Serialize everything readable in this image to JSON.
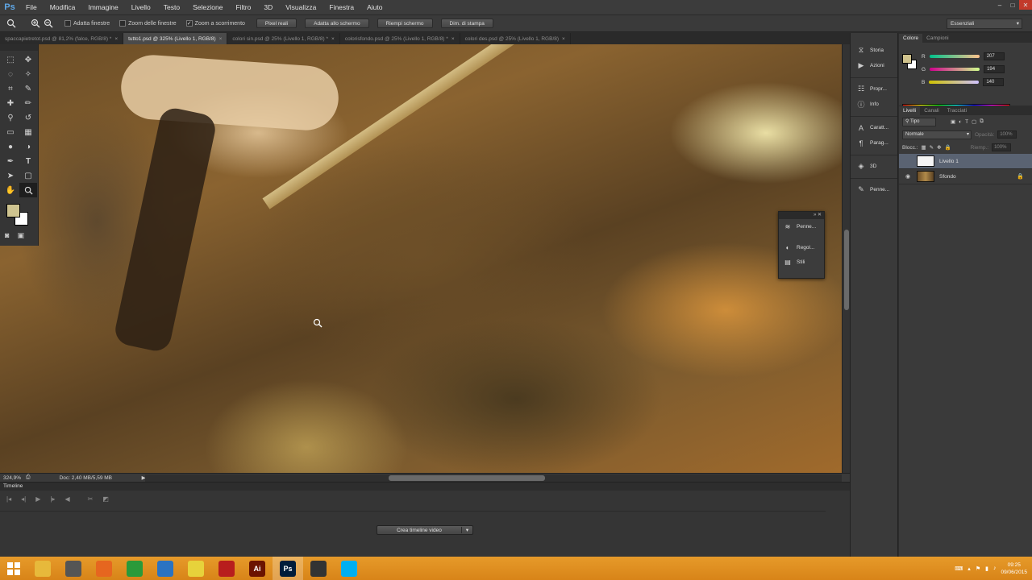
{
  "app": {
    "logo": "Ps"
  },
  "menu": [
    "File",
    "Modifica",
    "Immagine",
    "Livello",
    "Testo",
    "Selezione",
    "Filtro",
    "3D",
    "Visualizza",
    "Finestra",
    "Aiuto"
  ],
  "window_controls": [
    "–",
    "□",
    "✕"
  ],
  "options": {
    "checks": [
      {
        "label": "Adatta finestre",
        "checked": false
      },
      {
        "label": "Zoom delle finestre",
        "checked": false
      },
      {
        "label": "Zoom a scorrimento",
        "checked": true
      }
    ],
    "buttons": [
      "Pixel reali",
      "Adatta allo schermo",
      "Riempi schermo",
      "Dim. di stampa"
    ],
    "workspace": "Essenziali"
  },
  "tabs": [
    {
      "label": "spaccapietretot.psd @ 81,2% (falce, RGB/8) *",
      "active": false
    },
    {
      "label": "tutto1.psd @ 325% (Livello 1, RGB/8)",
      "active": true
    },
    {
      "label": "colori sin.psd @ 25% (Livello 1, RGB/8) *",
      "active": false
    },
    {
      "label": "colorisfondo.psd @ 25% (Livello 1, RGB/8) *",
      "active": false
    },
    {
      "label": "colori des.psd @ 25% (Livello 1, RGB/8)",
      "active": false
    }
  ],
  "status": {
    "zoom": "324,9%",
    "doc": "Doc: 2,40 MB/5,59 MB"
  },
  "timeline": {
    "title": "Timeline",
    "create_button": "Crea timeline video"
  },
  "float_panel": [
    {
      "icon": "brush-presets-icon",
      "label": "Penne..."
    },
    {
      "icon": "adjustments-icon",
      "label": "Regol..."
    },
    {
      "icon": "styles-icon",
      "label": "Stili"
    }
  ],
  "dock": [
    {
      "icon": "history-icon",
      "label": "Storia"
    },
    {
      "icon": "play-icon",
      "label": "Azioni"
    },
    {
      "icon": "properties-icon",
      "label": "Propr..."
    },
    {
      "icon": "info-icon",
      "label": "Info"
    },
    {
      "icon": "character-icon",
      "label": "Caratt..."
    },
    {
      "icon": "paragraph-icon",
      "label": "Parag..."
    },
    {
      "icon": "3d-icon",
      "label": "3D"
    },
    {
      "icon": "brush-icon",
      "label": "Penne..."
    }
  ],
  "color_panel": {
    "tabs": [
      "Colore",
      "Campioni"
    ],
    "fg_color": "#cfc28c",
    "channels": [
      {
        "name": "R",
        "value": "207"
      },
      {
        "name": "G",
        "value": "194"
      },
      {
        "name": "B",
        "value": "140"
      }
    ]
  },
  "layers_panel": {
    "tabs": [
      "Livelli",
      "Canali",
      "Tracciati"
    ],
    "filter": "Tipo",
    "blend_mode": "Normale",
    "opacity_label": "Opacità:",
    "opacity_value": "100%",
    "lock_label": "Blocc.:",
    "fill_label": "Riemp.:",
    "fill_value": "100%",
    "layers": [
      {
        "name": "Livello 1",
        "selected": true,
        "visible": false
      },
      {
        "name": "Sfondo",
        "selected": false,
        "visible": true,
        "locked": true
      }
    ]
  },
  "taskbar": {
    "apps": [
      {
        "icon": "file-explorer-icon",
        "color": "#e7b93b"
      },
      {
        "icon": "steam-icon",
        "color": "#555"
      },
      {
        "icon": "firefox-icon",
        "color": "#e6661f"
      },
      {
        "icon": "spreadsheet-icon",
        "color": "#2a9a3a"
      },
      {
        "icon": "chrome-icon",
        "color": "#2b73c2"
      },
      {
        "icon": "apps-grid-icon",
        "color": "#e7d23b"
      },
      {
        "icon": "games-icon",
        "color": "#b81d1d"
      },
      {
        "icon": "illustrator-icon",
        "color": "#6b1300",
        "label": "Ai"
      },
      {
        "icon": "photoshop-icon",
        "color": "#001c3a",
        "label": "Ps",
        "active": true
      },
      {
        "icon": "inkscape-icon",
        "color": "#333"
      },
      {
        "icon": "skype-icon",
        "color": "#00aff0"
      }
    ],
    "time": "09:25",
    "date": "09/06/2015"
  }
}
